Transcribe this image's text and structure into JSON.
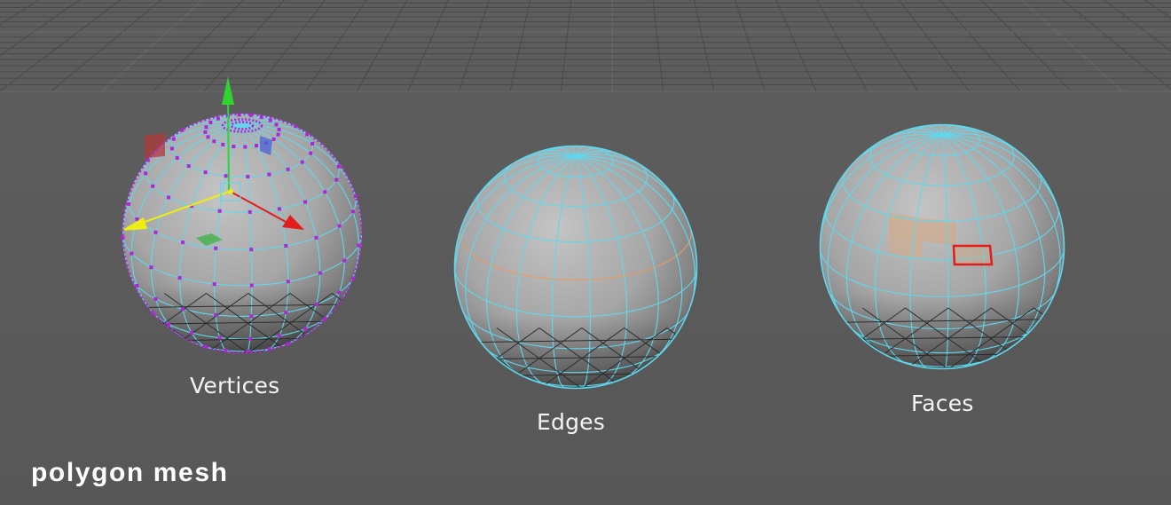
{
  "viewport": {
    "background": "#5b5b5b",
    "grid_color": "#4a4a4a",
    "grid_highlight": "#696969"
  },
  "labels": {
    "vertices": "Vertices",
    "edges": "Edges",
    "faces": "Faces"
  },
  "caption": "polygon mesh",
  "colors": {
    "wire": "#5fd8ee",
    "vertex_dots": "#b026d6",
    "edge_highlight": "#e79a63",
    "face_selected_outline": "#e31b1b",
    "face_highlight": "#d9a67a",
    "sphere_base": "#a7a7a7",
    "axis_y": "#2fd431",
    "axis_x": "#e11d1d",
    "axis_z": "#eded12"
  },
  "icons": {
    "gizmo": "move-tool-gizmo-icon"
  }
}
